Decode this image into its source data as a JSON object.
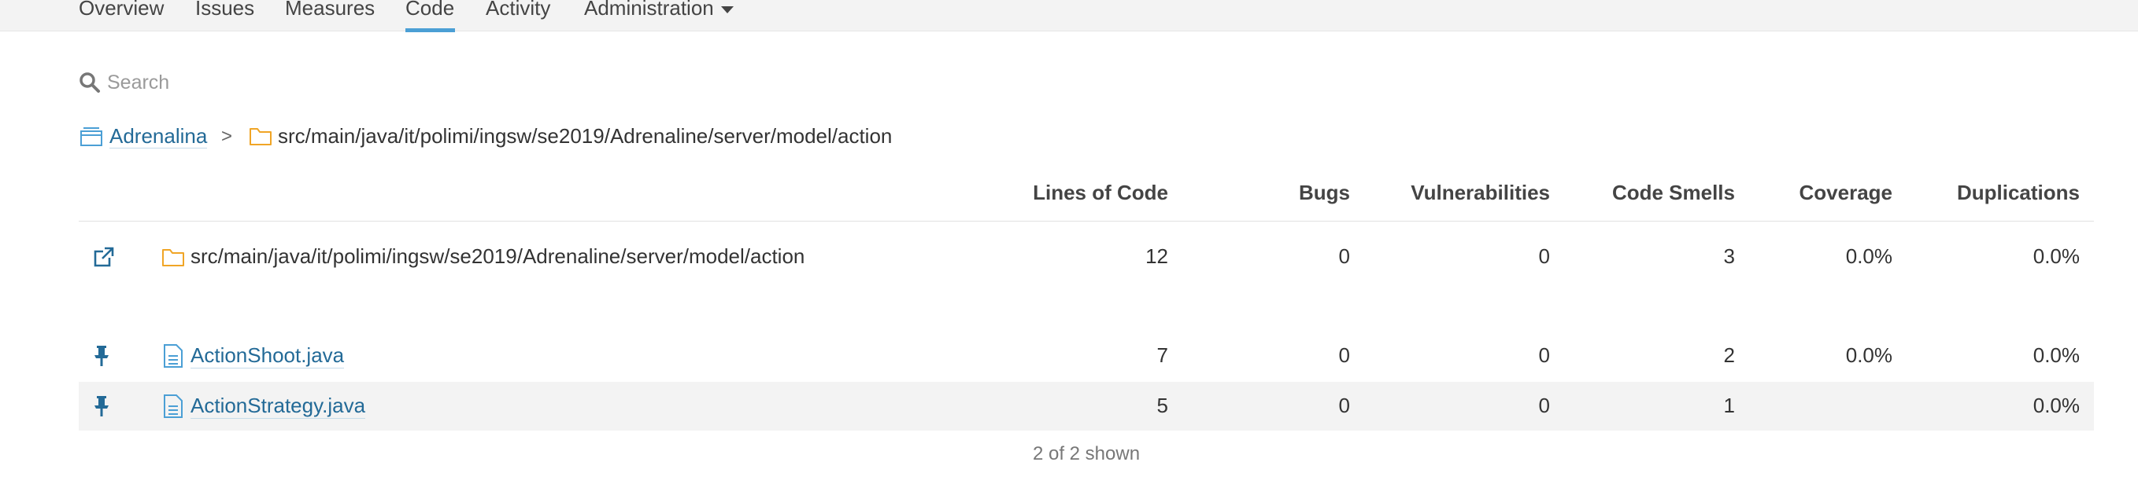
{
  "nav": {
    "tabs": [
      {
        "label": "Overview"
      },
      {
        "label": "Issues"
      },
      {
        "label": "Measures"
      },
      {
        "label": "Code"
      },
      {
        "label": "Activity"
      },
      {
        "label": "Administration"
      }
    ],
    "active_tab": "Code"
  },
  "search": {
    "placeholder": "Search",
    "value": ""
  },
  "breadcrumb": {
    "project": "Adrenalina",
    "separator": ">",
    "directory": "src/main/java/it/polimi/ingsw/se2019/Adrenaline/server/model/action"
  },
  "table": {
    "headers": {
      "loc": "Lines of Code",
      "bugs": "Bugs",
      "vulnerabilities": "Vulnerabilities",
      "code_smells": "Code Smells",
      "coverage": "Coverage",
      "duplications": "Duplications"
    },
    "base_row": {
      "name": "src/main/java/it/polimi/ingsw/se2019/Adrenaline/server/model/action",
      "loc": "12",
      "bugs": "0",
      "vulnerabilities": "0",
      "code_smells": "3",
      "coverage": "0.0%",
      "duplications": "0.0%"
    },
    "files": [
      {
        "name": "ActionShoot.java",
        "loc": "7",
        "bugs": "0",
        "vulnerabilities": "0",
        "code_smells": "2",
        "coverage": "0.0%",
        "duplications": "0.0%"
      },
      {
        "name": "ActionStrategy.java",
        "loc": "5",
        "bugs": "0",
        "vulnerabilities": "0",
        "code_smells": "1",
        "coverage": "",
        "duplications": "0.0%"
      }
    ]
  },
  "footer": {
    "shown": "2 of 2 shown"
  },
  "colors": {
    "link": "#236a97",
    "active_tab": "#4b9fd5",
    "folder": "#f0a526",
    "row_highlight": "#f3f3f3"
  }
}
